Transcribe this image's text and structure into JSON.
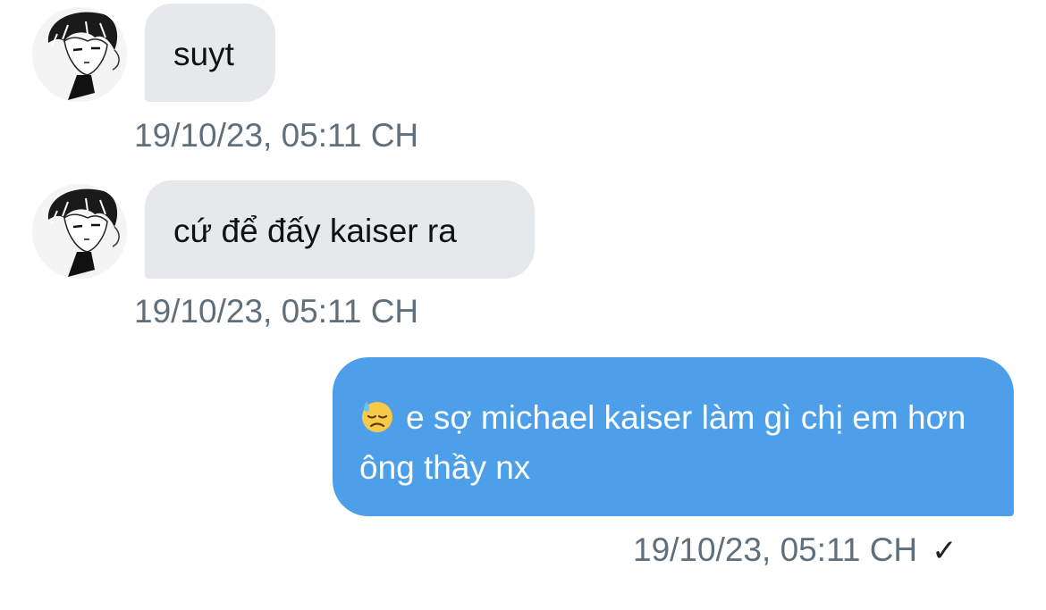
{
  "messages": [
    {
      "direction": "incoming",
      "avatar": "manga-character-avatar",
      "text": "suyt",
      "timestamp": "19/10/23, 05:11 CH"
    },
    {
      "direction": "incoming",
      "avatar": "manga-character-avatar",
      "text": "cứ để đấy kaiser ra",
      "timestamp": "19/10/23, 05:11 CH"
    },
    {
      "direction": "outgoing",
      "emoji": "downcast-face-with-sweat-icon",
      "text": "e sợ michael kaiser làm gì chị em hơn ông thầy nx",
      "timestamp": "19/10/23, 05:11 CH",
      "status": "✓"
    }
  ],
  "colors": {
    "incoming_bubble": "#e6e9ec",
    "outgoing_bubble": "#4d9fea",
    "timestamp": "#5f6f7c"
  }
}
